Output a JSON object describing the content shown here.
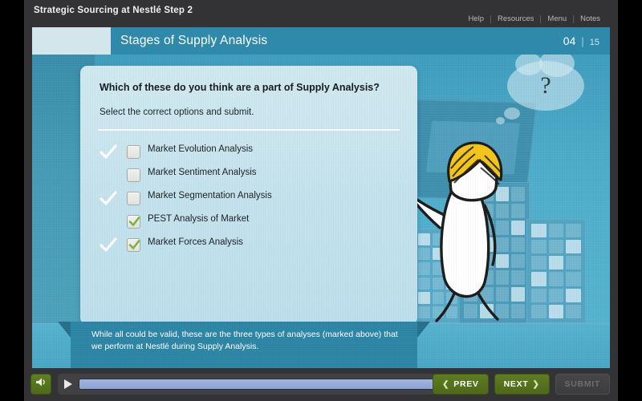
{
  "header": {
    "course_title": "Strategic Sourcing at Nestlé Step 2",
    "util_nav": [
      {
        "label": "Help",
        "name": "help"
      },
      {
        "label": "Resources",
        "name": "resources"
      },
      {
        "label": "Menu",
        "name": "menu"
      },
      {
        "label": "Notes",
        "name": "notes"
      }
    ]
  },
  "title_strip": {
    "page_heading": "Stages of Supply Analysis",
    "current_page": "04",
    "separator": "|",
    "total_pages": "15"
  },
  "question": {
    "prompt": "Which of these do you think are a part of Supply Analysis?",
    "instruction": "Select the correct options and submit.",
    "options": [
      {
        "label": "Market Evolution Analysis",
        "checked": false,
        "correct": true
      },
      {
        "label": "Market Sentiment Analysis",
        "checked": false,
        "correct": false
      },
      {
        "label": "Market Segmentation Analysis",
        "checked": false,
        "correct": true
      },
      {
        "label": "PEST Analysis of Market",
        "checked": true,
        "correct": false
      },
      {
        "label": "Market Forces Analysis",
        "checked": true,
        "correct": true
      }
    ]
  },
  "feedback": {
    "text": "While all could be valid, these are the three types of analyses (marked above) that we perform at Nestlé during Supply Analysis."
  },
  "illustration": {
    "thought_bubble_text": "?"
  },
  "controls": {
    "volume_icon": "speaker-icon",
    "play_icon": "play-icon",
    "replay_icon": "replay-icon",
    "progress_percent": 100,
    "prev_label": "PREV",
    "prev_chevron": "❮",
    "next_label": "NEXT",
    "next_chevron": "❯",
    "submit_label": "SUBMIT",
    "submit_enabled": false
  },
  "colors": {
    "chrome": "#333234",
    "accent_blue": "#2f89aa",
    "panel_blue": "#c6e4ef",
    "banner_blue": "#2c85a5",
    "green_button": "#5e7d22",
    "check_green": "#7fb13f",
    "progress_blue": "#9fb4e0",
    "hair_yellow": "#f5c518"
  }
}
